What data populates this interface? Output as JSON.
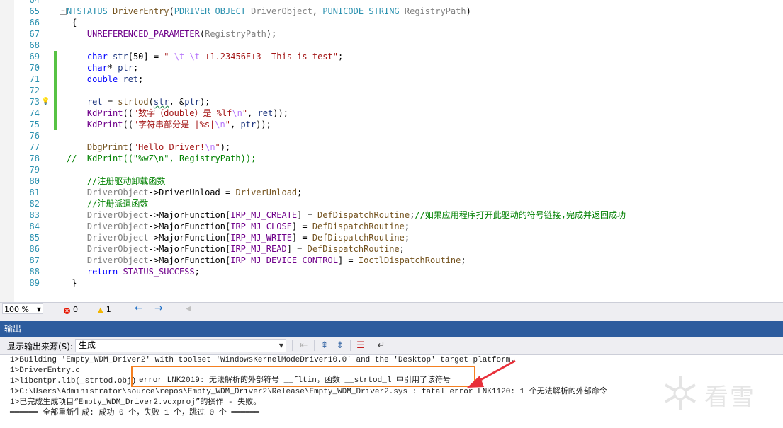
{
  "editor": {
    "lines": [
      {
        "n": "64",
        "segs": [
          {
            "t": "",
            "c": ""
          }
        ]
      },
      {
        "n": "65",
        "fold": "−",
        "segs": [
          {
            "t": "NTSTATUS ",
            "c": "t"
          },
          {
            "t": "DriverEntry",
            "c": "f"
          },
          {
            "t": "(",
            "c": ""
          },
          {
            "t": "PDRIVER_OBJECT ",
            "c": "t"
          },
          {
            "t": "DriverObject",
            "c": "p"
          },
          {
            "t": ", ",
            "c": ""
          },
          {
            "t": "PUNICODE_STRING ",
            "c": "t"
          },
          {
            "t": "RegistryPath",
            "c": "p"
          },
          {
            "t": ")",
            "c": ""
          }
        ]
      },
      {
        "n": "66",
        "segs": [
          {
            "t": " {",
            "c": ""
          }
        ]
      },
      {
        "n": "67",
        "segs": [
          {
            "t": "    ",
            "c": ""
          },
          {
            "t": "UNREFERENCED_PARAMETER",
            "c": "m"
          },
          {
            "t": "(",
            "c": ""
          },
          {
            "t": "RegistryPath",
            "c": "p"
          },
          {
            "t": ");",
            "c": ""
          }
        ]
      },
      {
        "n": "68",
        "segs": [
          {
            "t": "",
            "c": ""
          }
        ]
      },
      {
        "n": "69",
        "chg": true,
        "segs": [
          {
            "t": "    ",
            "c": ""
          },
          {
            "t": "char ",
            "c": "k"
          },
          {
            "t": "str",
            "c": "v"
          },
          {
            "t": "[50] = ",
            "c": ""
          },
          {
            "t": "\" ",
            "c": "s"
          },
          {
            "t": "\\t ",
            "c": "esc"
          },
          {
            "t": "\\t ",
            "c": "esc"
          },
          {
            "t": "+1.23456E+3--This is test\"",
            "c": "s"
          },
          {
            "t": ";",
            "c": ""
          }
        ]
      },
      {
        "n": "70",
        "chg": true,
        "segs": [
          {
            "t": "    ",
            "c": ""
          },
          {
            "t": "char",
            "c": "k"
          },
          {
            "t": "* ",
            "c": ""
          },
          {
            "t": "ptr",
            "c": "v"
          },
          {
            "t": ";",
            "c": ""
          }
        ]
      },
      {
        "n": "71",
        "chg": true,
        "segs": [
          {
            "t": "    ",
            "c": ""
          },
          {
            "t": "double ",
            "c": "k"
          },
          {
            "t": "ret",
            "c": "v"
          },
          {
            "t": ";",
            "c": ""
          }
        ]
      },
      {
        "n": "72",
        "chg": true,
        "segs": [
          {
            "t": "",
            "c": ""
          }
        ]
      },
      {
        "n": "73",
        "chg": true,
        "bulb": true,
        "segs": [
          {
            "t": "    ",
            "c": ""
          },
          {
            "t": "ret",
            "c": "v"
          },
          {
            "t": " = ",
            "c": ""
          },
          {
            "t": "strtod",
            "c": "f"
          },
          {
            "t": "(",
            "c": ""
          },
          {
            "t": "str",
            "c": "v squig"
          },
          {
            "t": ", &",
            "c": ""
          },
          {
            "t": "ptr",
            "c": "v"
          },
          {
            "t": ");",
            "c": ""
          }
        ]
      },
      {
        "n": "74",
        "chg": true,
        "segs": [
          {
            "t": "    ",
            "c": ""
          },
          {
            "t": "KdPrint",
            "c": "m"
          },
          {
            "t": "((",
            "c": ""
          },
          {
            "t": "\"数字（double）是 %lf",
            "c": "s"
          },
          {
            "t": "\\n",
            "c": "esc"
          },
          {
            "t": "\"",
            "c": "s"
          },
          {
            "t": ", ",
            "c": ""
          },
          {
            "t": "ret",
            "c": "v"
          },
          {
            "t": "));",
            "c": ""
          }
        ]
      },
      {
        "n": "75",
        "chg": true,
        "segs": [
          {
            "t": "    ",
            "c": ""
          },
          {
            "t": "KdPrint",
            "c": "m"
          },
          {
            "t": "((",
            "c": ""
          },
          {
            "t": "\"字符串部分是 |%s|",
            "c": "s"
          },
          {
            "t": "\\n",
            "c": "esc"
          },
          {
            "t": "\"",
            "c": "s"
          },
          {
            "t": ", ",
            "c": ""
          },
          {
            "t": "ptr",
            "c": "v"
          },
          {
            "t": "));",
            "c": ""
          }
        ]
      },
      {
        "n": "76",
        "segs": [
          {
            "t": "",
            "c": ""
          }
        ]
      },
      {
        "n": "77",
        "segs": [
          {
            "t": "    ",
            "c": ""
          },
          {
            "t": "DbgPrint",
            "c": "f"
          },
          {
            "t": "(",
            "c": ""
          },
          {
            "t": "\"Hello Driver!",
            "c": "s"
          },
          {
            "t": "\\n",
            "c": "esc"
          },
          {
            "t": "\"",
            "c": "s"
          },
          {
            "t": ");",
            "c": ""
          }
        ]
      },
      {
        "n": "78",
        "segs": [
          {
            "t": "//  KdPrint((\"%wZ\\n\", RegistryPath));",
            "c": "c"
          }
        ]
      },
      {
        "n": "79",
        "segs": [
          {
            "t": "",
            "c": ""
          }
        ]
      },
      {
        "n": "80",
        "segs": [
          {
            "t": "    ",
            "c": ""
          },
          {
            "t": "//注册驱动卸载函数",
            "c": "c"
          }
        ]
      },
      {
        "n": "81",
        "segs": [
          {
            "t": "    ",
            "c": ""
          },
          {
            "t": "DriverObject",
            "c": "p"
          },
          {
            "t": "->",
            "c": ""
          },
          {
            "t": "DriverUnload",
            "c": ""
          },
          {
            "t": " = ",
            "c": ""
          },
          {
            "t": "DriverUnload",
            "c": "f"
          },
          {
            "t": ";",
            "c": ""
          }
        ]
      },
      {
        "n": "82",
        "segs": [
          {
            "t": "    ",
            "c": ""
          },
          {
            "t": "//注册派遣函数",
            "c": "c"
          }
        ]
      },
      {
        "n": "83",
        "segs": [
          {
            "t": "    ",
            "c": ""
          },
          {
            "t": "DriverObject",
            "c": "p"
          },
          {
            "t": "->",
            "c": ""
          },
          {
            "t": "MajorFunction",
            "c": ""
          },
          {
            "t": "[",
            "c": ""
          },
          {
            "t": "IRP_MJ_CREATE",
            "c": "m"
          },
          {
            "t": "] = ",
            "c": ""
          },
          {
            "t": "DefDispatchRoutine",
            "c": "f"
          },
          {
            "t": ";",
            "c": ""
          },
          {
            "t": "//如果应用程序打开此驱动的符号链接,完成并返回成功",
            "c": "c"
          }
        ]
      },
      {
        "n": "84",
        "segs": [
          {
            "t": "    ",
            "c": ""
          },
          {
            "t": "DriverObject",
            "c": "p"
          },
          {
            "t": "->",
            "c": ""
          },
          {
            "t": "MajorFunction",
            "c": ""
          },
          {
            "t": "[",
            "c": ""
          },
          {
            "t": "IRP_MJ_CLOSE",
            "c": "m"
          },
          {
            "t": "] = ",
            "c": ""
          },
          {
            "t": "DefDispatchRoutine",
            "c": "f"
          },
          {
            "t": ";",
            "c": ""
          }
        ]
      },
      {
        "n": "85",
        "segs": [
          {
            "t": "    ",
            "c": ""
          },
          {
            "t": "DriverObject",
            "c": "p"
          },
          {
            "t": "->",
            "c": ""
          },
          {
            "t": "MajorFunction",
            "c": ""
          },
          {
            "t": "[",
            "c": ""
          },
          {
            "t": "IRP_MJ_WRITE",
            "c": "m"
          },
          {
            "t": "] = ",
            "c": ""
          },
          {
            "t": "DefDispatchRoutine",
            "c": "f"
          },
          {
            "t": ";",
            "c": ""
          }
        ]
      },
      {
        "n": "86",
        "segs": [
          {
            "t": "    ",
            "c": ""
          },
          {
            "t": "DriverObject",
            "c": "p"
          },
          {
            "t": "->",
            "c": ""
          },
          {
            "t": "MajorFunction",
            "c": ""
          },
          {
            "t": "[",
            "c": ""
          },
          {
            "t": "IRP_MJ_READ",
            "c": "m"
          },
          {
            "t": "] = ",
            "c": ""
          },
          {
            "t": "DefDispatchRoutine",
            "c": "f"
          },
          {
            "t": ";",
            "c": ""
          }
        ]
      },
      {
        "n": "87",
        "segs": [
          {
            "t": "    ",
            "c": ""
          },
          {
            "t": "DriverObject",
            "c": "p"
          },
          {
            "t": "->",
            "c": ""
          },
          {
            "t": "MajorFunction",
            "c": ""
          },
          {
            "t": "[",
            "c": ""
          },
          {
            "t": "IRP_MJ_DEVICE_CONTROL",
            "c": "m"
          },
          {
            "t": "] = ",
            "c": ""
          },
          {
            "t": "IoctlDispatchRoutine",
            "c": "f"
          },
          {
            "t": ";",
            "c": ""
          }
        ]
      },
      {
        "n": "88",
        "segs": [
          {
            "t": "    ",
            "c": ""
          },
          {
            "t": "return ",
            "c": "k"
          },
          {
            "t": "STATUS_SUCCESS",
            "c": "m"
          },
          {
            "t": ";",
            "c": ""
          }
        ]
      },
      {
        "n": "89",
        "segs": [
          {
            "t": " }",
            "c": ""
          }
        ]
      }
    ]
  },
  "statusbar": {
    "zoom": "100 %",
    "errors": "0",
    "warnings": "1"
  },
  "output": {
    "title": "输出",
    "source_label": "显示输出来源(S):",
    "source_value": "生成",
    "lines": [
      "1>Building 'Empty_WDM_Driver2' with toolset 'WindowsKernelModeDriver10.0' and the 'Desktop' target platform.",
      "1>DriverEntry.c",
      "1>libcntpr.lib(_strtod.obj)",
      "1>C:\\Users\\Administrator\\source\\repos\\Empty_WDM_Driver2\\Release\\Empty_WDM_Driver2.sys : fatal error LNK1120: 1 个无法解析的外部命令",
      "1>已完成生成项目“Empty_WDM_Driver2.vcxproj”的操作 - 失败。",
      "══════ 全部重新生成: 成功 0 个，失败 1 个，跳过 0 个 ══════"
    ],
    "error_line": "error LNK2019: 无法解析的外部符号 __fltin，函数 __strtod_l 中引用了该符号",
    "annotation_color": "#f47f20",
    "arrow_color": "#e8303a"
  },
  "watermark": {
    "text": "看雪"
  }
}
